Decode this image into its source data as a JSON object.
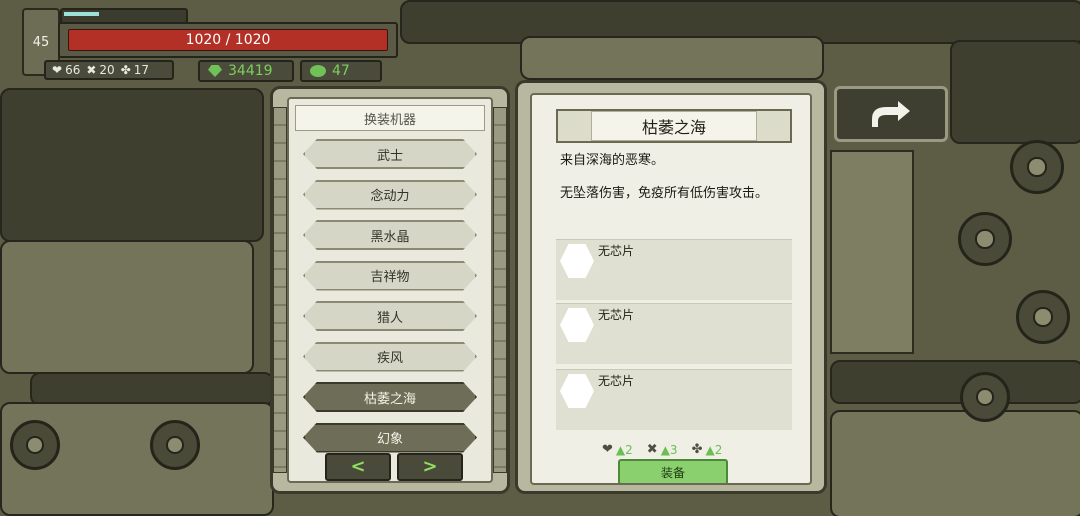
{
  "hud": {
    "level": "45",
    "xp_fraction": 0.3,
    "hp_text": "1020 / 1020",
    "stats": [
      {
        "icon": "heart-icon",
        "glyph": "❤",
        "value": "66"
      },
      {
        "icon": "crossed-wrench-icon",
        "glyph": "✖",
        "value": "20"
      },
      {
        "icon": "clover-icon",
        "glyph": "✤",
        "value": "17"
      }
    ],
    "gems": "34419",
    "orbs": "47"
  },
  "left_panel": {
    "title": "换装机器",
    "mechs": [
      "武士",
      "念动力",
      "黑水晶",
      "吉祥物",
      "猎人",
      "疾风",
      "枯萎之海",
      "幻象"
    ],
    "selected_index": 6,
    "prev_glyph": "<",
    "next_glyph": ">"
  },
  "right_panel": {
    "mech_name": "枯萎之海",
    "desc_line1": "来自深海的恶寒。",
    "desc_line2": "无坠落伤害，免疫所有低伤害攻击。",
    "chip_slots": [
      "无芯片",
      "无芯片",
      "无芯片"
    ],
    "bonuses": [
      {
        "icon": "heart-icon",
        "glyph": "❤",
        "value": "▲2"
      },
      {
        "icon": "crossed-wrench-icon",
        "glyph": "✖",
        "value": "▲3"
      },
      {
        "icon": "clover-icon",
        "glyph": "✤",
        "value": "▲2"
      }
    ],
    "equip_label": "装备"
  },
  "colors": {
    "hp": "#b23025",
    "gem_green": "#6fc257",
    "equip_green": "#8bd06e"
  }
}
